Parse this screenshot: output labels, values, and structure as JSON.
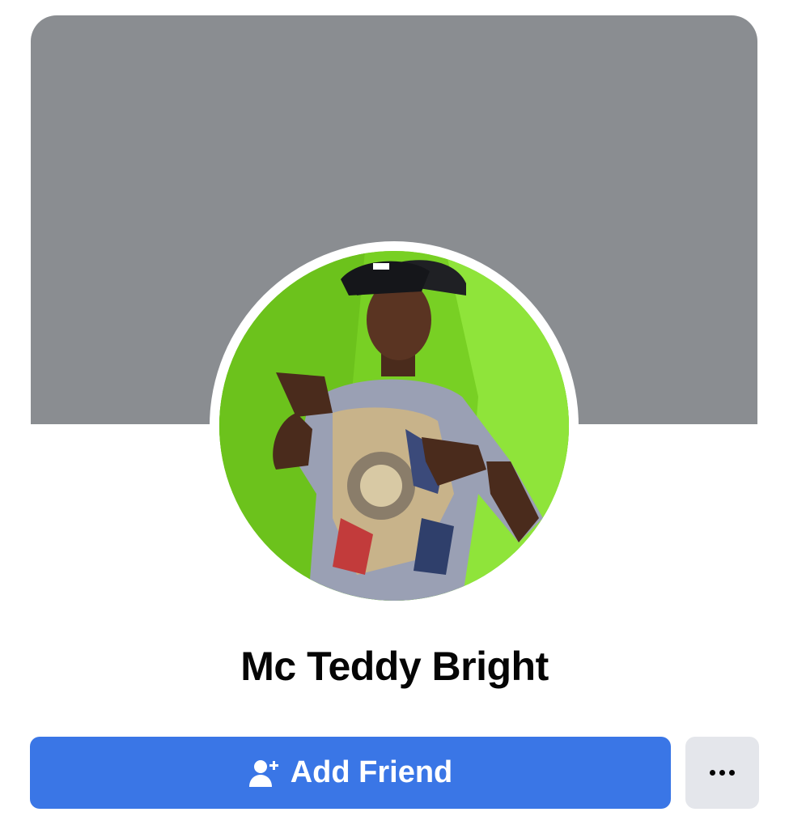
{
  "profile": {
    "name": "Mc Teddy Bright",
    "cover_color": "#8a8d91",
    "avatar": {
      "description_icon": "profile-photo",
      "background_color": "#7fd62a"
    }
  },
  "actions": {
    "add_friend_label": "Add Friend",
    "add_friend_icon": "add-person-icon",
    "more_icon": "ellipsis-icon",
    "primary_color": "#3a76e6",
    "secondary_bg": "#e4e6eb"
  }
}
